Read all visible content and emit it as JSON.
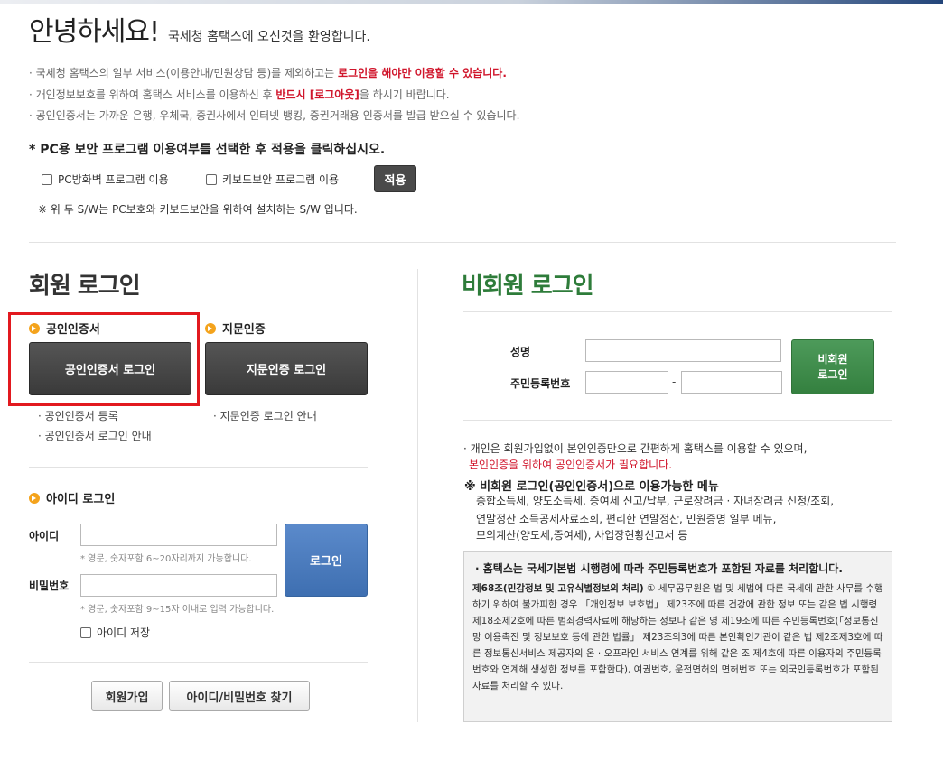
{
  "greeting": {
    "title": "안녕하세요!",
    "subtitle": "국세청 홈택스에 오신것을 환영합니다."
  },
  "notices": [
    {
      "before": "국세청 홈택스의 일부 서비스(이용안내/민원상담 등)를 제외하고는 ",
      "highlight": "로그인을 해야만 이용할 수 있습니다.",
      "after": ""
    },
    {
      "before": "개인정보보호를 위하여 홈택스 서비스를 이용하신 후 ",
      "highlight": "반드시 [로그아웃]",
      "after": "을 하시기 바랍니다."
    },
    {
      "before": "공인인증서는 가까운 은행, 우체국, 증권사에서 인터넷 뱅킹, 증권거래용 인증서를 발급 받으실 수 있습니다.",
      "highlight": "",
      "after": ""
    }
  ],
  "security": {
    "title": "* PC용 보안 프로그램 이용여부를 선택한 후 적용을 클릭하십시오.",
    "firewall_label": "PC방화벽 프로그램 이용",
    "keyboard_label": "키보드보안 프로그램 이용",
    "apply_label": "적용",
    "note": "※ 위 두 S/W는 PC보호와 키보드보안을 위하여 설치하는 S/W 입니다."
  },
  "member": {
    "title": "회원 로그인",
    "cert_heading": "공인인증서",
    "cert_button": "공인인증서 로그인",
    "cert_links": [
      "공인인증서 등록",
      "공인인증서 로그인 안내"
    ],
    "finger_heading": "지문인증",
    "finger_button": "지문인증 로그인",
    "finger_links": [
      "지문인증 로그인 안내"
    ],
    "id_heading": "아이디 로그인",
    "id_label": "아이디",
    "id_hint": "* 영문, 숫자포함 6~20자리까지 가능합니다.",
    "pw_label": "비밀번호",
    "pw_hint": "* 영문, 숫자포함 9~15자 이내로 입력 가능합니다.",
    "login_button": "로그인",
    "save_id_label": "아이디 저장",
    "join_button": "회원가입",
    "find_button": "아이디/비밀번호 찾기"
  },
  "nonmember": {
    "title": "비회원 로그인",
    "name_label": "성명",
    "rrn_label": "주민등록번호",
    "dash": "-",
    "login_line1": "비회원",
    "login_line2": "로그인",
    "info1": "개인은 회원가입없이 본인인증만으로 간편하게 홈택스를 이용할 수 있으며,",
    "info2": "본인인증을 위하여 공인인증서가 필요합니다.",
    "menu_title": "※ 비회원 로그인(공인인증서)으로 이용가능한 메뉴",
    "menu_lines": [
      "종합소득세, 양도소득세, 증여세 신고/납부, 근로장려금 · 자녀장려금 신청/조회,",
      "연말정산 소득공제자료조회, 편리한 연말정산, 민원증명 일부 메뉴,",
      "모의계산(양도세,증여세), 사업장현황신고서 등"
    ],
    "law_head": "홈택스는 국세기본법 시행령에 따라 주민등록번호가 포함된 자료를 처리합니다.",
    "law_bold": "제68조(민감정보 및 고유식별정보의 처리)",
    "law_text": " ① 세무공무원은 법 및 세법에 따른 국세에 관한 사무를 수행하기 위하여 불가피한 경우 「개인정보 보호법」 제23조에 따른 건강에 관한 정보 또는 같은 법 시행령 제18조제2호에 따른 범죄경력자료에 해당하는 정보나 같은 영 제19조에 따른 주민등록번호(「정보통신망 이용촉진 및 정보보호 등에 관한 법률」 제23조의3에 따른 본인확인기관이 같은 법 제2조제3호에 따른 정보통신서비스 제공자의 온 · 오프라인 서비스 연계를 위해 같은 조 제4호에 따른 이용자의 주민등록번호와 연계해 생성한 정보를 포함한다), 여권번호, 운전면허의 면허번호 또는 외국인등록번호가 포함된 자료를 처리할 수 있다."
  },
  "colors": {
    "member_title": "#333333",
    "nonmember_title": "#2e7c3a",
    "highlight_red": "#d0152b",
    "cert_box": "#e2191f"
  }
}
